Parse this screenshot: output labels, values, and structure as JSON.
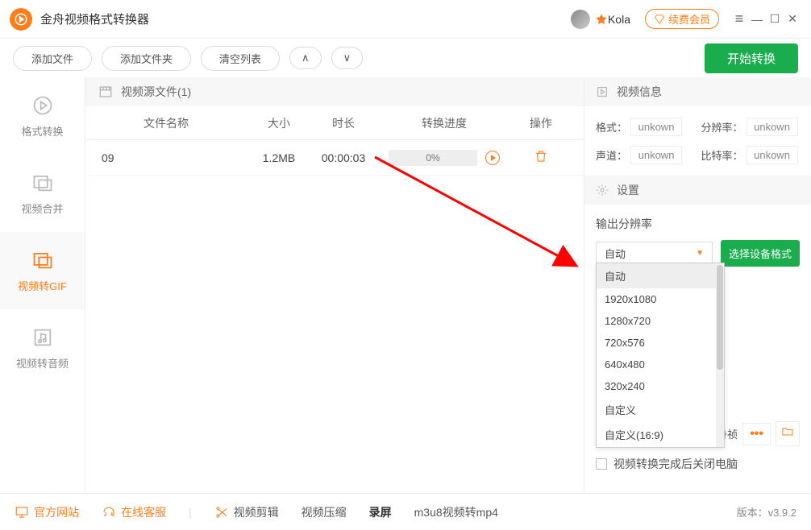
{
  "app": {
    "title": "金舟视频格式转换器"
  },
  "user": {
    "name": "Kola"
  },
  "renew_label": "续费会员",
  "toolbar": {
    "add_file": "添加文件",
    "add_folder": "添加文件夹",
    "clear_list": "清空列表",
    "start": "开始转换"
  },
  "sidebar": {
    "items": [
      {
        "label": "格式转换"
      },
      {
        "label": "视频合并"
      },
      {
        "label": "视频转GIF"
      },
      {
        "label": "视频转音频"
      }
    ]
  },
  "file_panel": {
    "header": "视频源文件(1)",
    "cols": {
      "name": "文件名称",
      "size": "大小",
      "dur": "时长",
      "prog": "转换进度",
      "op": "操作"
    },
    "rows": [
      {
        "name": "09",
        "size": "1.2MB",
        "dur": "00:00:03",
        "prog": "0%"
      }
    ]
  },
  "info": {
    "title": "视频信息",
    "format_label": "格式：",
    "format_val": "unkown",
    "res_label": "分辨率：",
    "res_val": "unkown",
    "channel_label": "声道：",
    "channel_val": "unkown",
    "bitrate_label": "比特率：",
    "bitrate_val": "unkown"
  },
  "settings": {
    "title": "设置",
    "output_res_label": "输出分辨率",
    "selected": "自动",
    "device_btn": "选择设备格式",
    "options": [
      "自动",
      "1920x1080",
      "1280x720",
      "720x576",
      "640x480",
      "320x240",
      "自定义",
      "自定义(16:9)"
    ],
    "jz": "金舟祯",
    "more": "•••",
    "shutdown": "视频转换完成后关闭电脑"
  },
  "footer": {
    "official": "官方网站",
    "service": "在线客服",
    "edit": "视频剪辑",
    "compress": "视频压缩",
    "record": "录屏",
    "m3u8": "m3u8视频转mp4",
    "version_label": "版本：",
    "version": "v3.9.2"
  }
}
